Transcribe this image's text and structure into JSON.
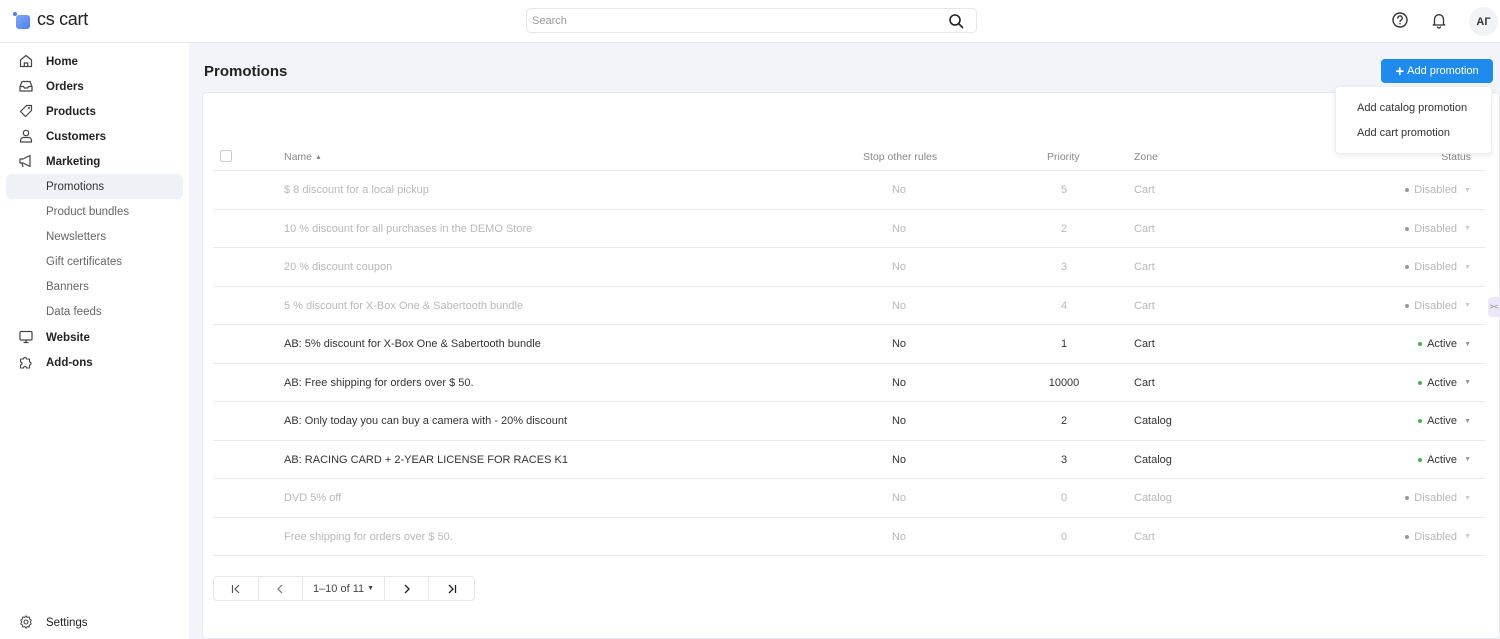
{
  "app": {
    "logo_text": "cs cart"
  },
  "topbar": {
    "search_placeholder": "Search",
    "search_value": "",
    "avatar_initials": "АГ"
  },
  "sidebar": {
    "items": [
      {
        "label": "Home",
        "icon": "home-icon"
      },
      {
        "label": "Orders",
        "icon": "inbox-icon"
      },
      {
        "label": "Products",
        "icon": "tag-icon"
      },
      {
        "label": "Customers",
        "icon": "user-icon"
      },
      {
        "label": "Marketing",
        "icon": "megaphone-icon"
      },
      {
        "label": "Promotions",
        "active": true
      },
      {
        "label": "Product bundles"
      },
      {
        "label": "Newsletters"
      },
      {
        "label": "Gift certificates"
      },
      {
        "label": "Banners"
      },
      {
        "label": "Data feeds"
      },
      {
        "label": "Website",
        "icon": "monitor-icon"
      },
      {
        "label": "Add-ons",
        "icon": "puzzle-icon"
      }
    ],
    "settings_label": "Settings"
  },
  "page": {
    "title": "Promotions",
    "add_button_label": "Add promotion",
    "dropdown": [
      "Add catalog promotion",
      "Add cart promotion"
    ]
  },
  "table": {
    "columns": {
      "name": "Name",
      "stop": "Stop other rules",
      "priority": "Priority",
      "zone": "Zone",
      "status": "Status"
    },
    "sort": {
      "column": "name",
      "direction": "asc"
    },
    "rows": [
      {
        "name": "$ 8 discount for a local pickup",
        "stop": "No",
        "priority": "5",
        "zone": "Cart",
        "status": "Disabled"
      },
      {
        "name": "10 % discount for all purchases in the DEMO Store",
        "stop": "No",
        "priority": "2",
        "zone": "Cart",
        "status": "Disabled"
      },
      {
        "name": "20 % discount coupon",
        "stop": "No",
        "priority": "3",
        "zone": "Cart",
        "status": "Disabled"
      },
      {
        "name": "5 % discount for X-Box One & Sabertooth bundle",
        "stop": "No",
        "priority": "4",
        "zone": "Cart",
        "status": "Disabled"
      },
      {
        "name": "AB: 5% discount for X-Box One & Sabertooth bundle",
        "stop": "No",
        "priority": "1",
        "zone": "Cart",
        "status": "Active"
      },
      {
        "name": "AB: Free shipping for orders over $ 50.",
        "stop": "No",
        "priority": "10000",
        "zone": "Cart",
        "status": "Active"
      },
      {
        "name": "AB: Only today you can buy a camera with - 20% discount",
        "stop": "No",
        "priority": "2",
        "zone": "Catalog",
        "status": "Active"
      },
      {
        "name": "AB: RACING CARD + 2-YEAR LICENSE FOR RACES K1",
        "stop": "No",
        "priority": "3",
        "zone": "Catalog",
        "status": "Active"
      },
      {
        "name": "DVD 5% off",
        "stop": "No",
        "priority": "0",
        "zone": "Catalog",
        "status": "Disabled"
      },
      {
        "name": "Free shipping for orders over $ 50.",
        "stop": "No",
        "priority": "0",
        "zone": "Cart",
        "status": "Disabled"
      }
    ]
  },
  "pagination": {
    "range_label": "1–10 of 11"
  },
  "colors": {
    "accent": "#1f8bed",
    "active_dot": "#4caf50",
    "disabled_dot": "#999999"
  }
}
